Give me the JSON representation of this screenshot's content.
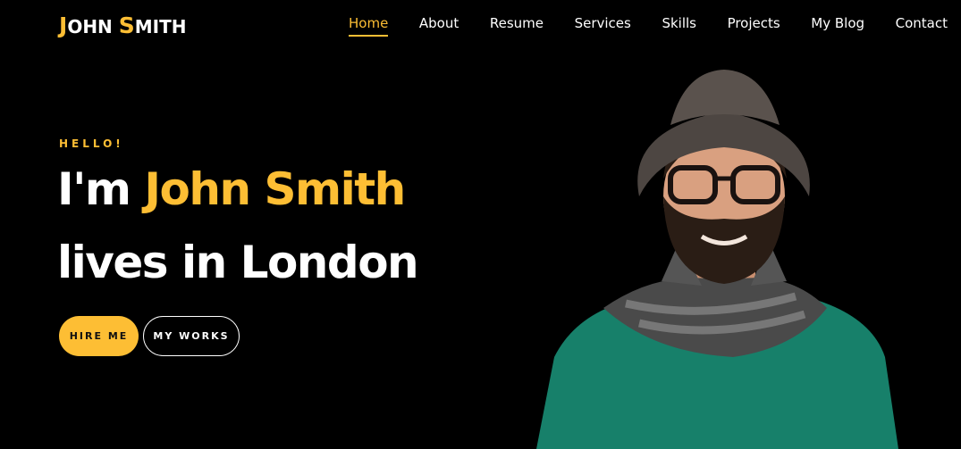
{
  "header": {
    "logo_first_initial": "J",
    "logo_first_rest": "OHN ",
    "logo_last_initial": "S",
    "logo_last_rest": "MITH",
    "nav": [
      "Home",
      "About",
      "Resume",
      "Services",
      "Skills",
      "Projects",
      "My Blog",
      "Contact"
    ],
    "active_nav": "Home"
  },
  "hero": {
    "greeting": "HELLO!",
    "title_prefix": "I'm ",
    "title_name": "John Smith",
    "title_line2": "lives in London",
    "hire_button": "HIRE ME",
    "works_button": "MY WORKS"
  },
  "colors": {
    "accent": "#fdbe34",
    "background": "#000000",
    "text": "#ffffff"
  }
}
